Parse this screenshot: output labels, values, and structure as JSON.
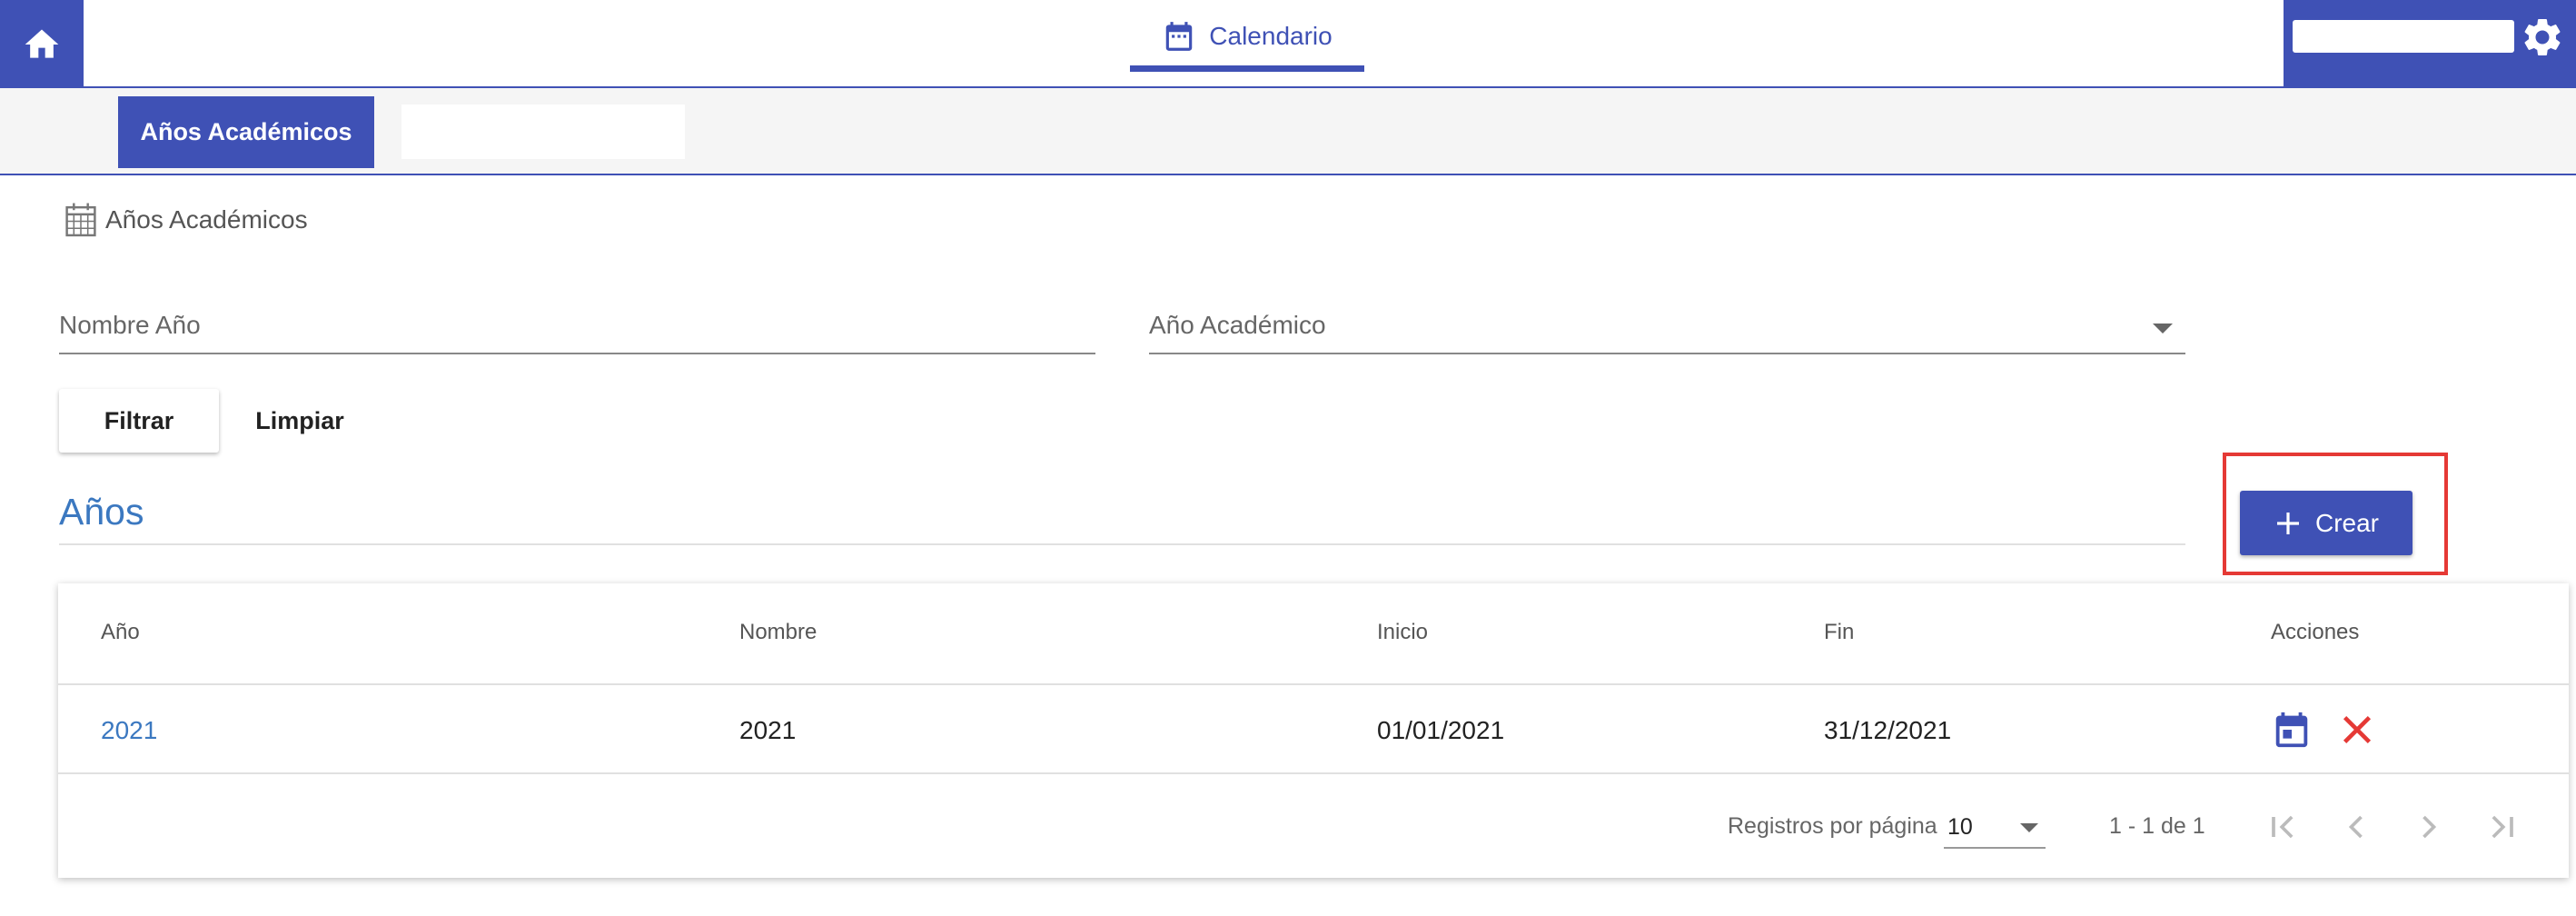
{
  "header": {
    "nav_tab_label": "Calendario",
    "home_icon": "home-icon",
    "calendar_icon": "calendar-icon",
    "settings_icon": "gear-icon"
  },
  "subnav": {
    "active_tab_label": "Años Académicos"
  },
  "breadcrumb": {
    "icon": "calendar-grid-icon",
    "label": "Años Académicos"
  },
  "filters": {
    "name_placeholder": "Nombre Año",
    "year_placeholder": "Año Académico",
    "filter_button": "Filtrar",
    "clear_button": "Limpiar"
  },
  "section": {
    "title": "Años",
    "create_button": "Crear"
  },
  "table": {
    "headers": [
      "Año",
      "Nombre",
      "Inicio",
      "Fin",
      "Acciones"
    ],
    "rows": [
      {
        "year": "2021",
        "name": "2021",
        "start": "01/01/2021",
        "end": "31/12/2021"
      }
    ]
  },
  "pagination": {
    "per_page_label": "Registros por página",
    "per_page_value": "10",
    "range": "1 - 1 de 1"
  },
  "colors": {
    "primary": "#3f51b5",
    "link": "#3b78c0",
    "danger": "#e53935"
  }
}
